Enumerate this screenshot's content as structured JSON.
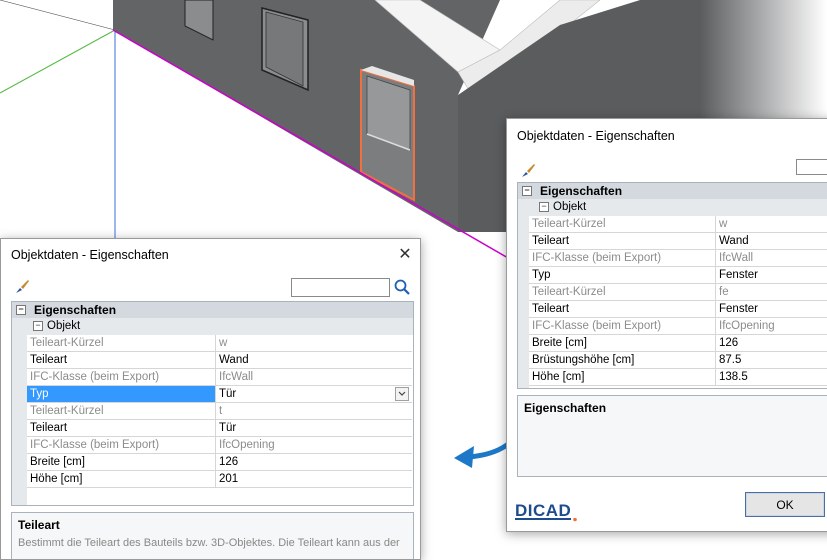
{
  "colors": {
    "accent": "#3399ff",
    "wall": "#626466",
    "magenta": "#cc00cc",
    "selection_orange": "#f07040",
    "arrow_blue": "#1e78c8",
    "logo": "#1d4d8d"
  },
  "front_dialog": {
    "title": "Objektdaten - Eigenschaften",
    "close_icon": "close-icon",
    "tool_icon": "brush-icon",
    "search_value": "",
    "search_icon": "search-icon",
    "section_label": "Eigenschaften",
    "group_label": "Objekt",
    "rows": [
      {
        "key": "Teileart-Kürzel",
        "value": "w",
        "readonly": true
      },
      {
        "key": "Teileart",
        "value": "Wand",
        "readonly": false
      },
      {
        "key": "IFC-Klasse (beim Export)",
        "value": "IfcWall",
        "readonly": true
      },
      {
        "key": "Typ",
        "value": "Tür",
        "readonly": false,
        "selected": true,
        "dropdown": true
      },
      {
        "key": "Teileart-Kürzel",
        "value": "t",
        "readonly": true
      },
      {
        "key": "Teileart",
        "value": "Tür",
        "readonly": false
      },
      {
        "key": "IFC-Klasse (beim Export)",
        "value": "IfcOpening",
        "readonly": true
      },
      {
        "key": "Breite [cm]",
        "value": "126",
        "readonly": false
      },
      {
        "key": "Höhe [cm]",
        "value": "201",
        "readonly": false
      }
    ],
    "description_title": "Teileart",
    "description_text": "Bestimmt die Teileart des Bauteils bzw. 3D-Objektes. Die Teileart kann aus der"
  },
  "back_dialog": {
    "title": "Objektdaten - Eigenschaften",
    "tool_icon": "brush-icon",
    "section_label": "Eigenschaften",
    "group_label": "Objekt",
    "rows": [
      {
        "key": "Teileart-Kürzel",
        "value": "w",
        "readonly": true
      },
      {
        "key": "Teileart",
        "value": "Wand",
        "readonly": false
      },
      {
        "key": "IFC-Klasse (beim Export)",
        "value": "IfcWall",
        "readonly": true
      },
      {
        "key": "Typ",
        "value": "Fenster",
        "readonly": false
      },
      {
        "key": "Teileart-Kürzel",
        "value": "fe",
        "readonly": true
      },
      {
        "key": "Teileart",
        "value": "Fenster",
        "readonly": false
      },
      {
        "key": "IFC-Klasse (beim Export)",
        "value": "IfcOpening",
        "readonly": true
      },
      {
        "key": "Breite [cm]",
        "value": "126",
        "readonly": false
      },
      {
        "key": "Brüstungshöhe [cm]",
        "value": "87.5",
        "readonly": false
      },
      {
        "key": "Höhe [cm]",
        "value": "138.5",
        "readonly": false
      }
    ],
    "description_title": "Eigenschaften",
    "ok_label": "OK",
    "logo_text": "DICAD"
  }
}
